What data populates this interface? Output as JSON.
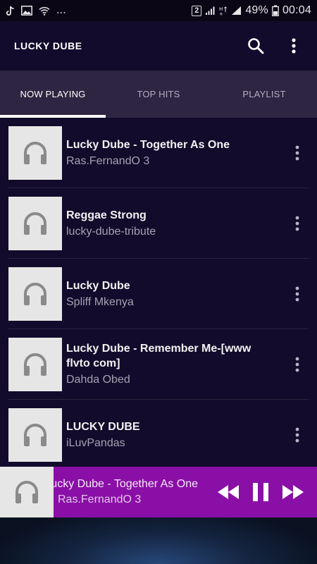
{
  "status_bar": {
    "notif_icons": [
      "tiktok-icon",
      "image-icon",
      "wifi-icon",
      "more-dots"
    ],
    "more": "...",
    "sim_badge": "2",
    "battery": "49%",
    "time": "00:04"
  },
  "app_bar": {
    "title": "LUCKY DUBE"
  },
  "tabs": [
    {
      "label": "NOW PLAYING",
      "active": true
    },
    {
      "label": "TOP HITS",
      "active": false
    },
    {
      "label": "PLAYLIST",
      "active": false
    }
  ],
  "tracks": [
    {
      "title": "Lucky Dube - Together As One",
      "subtitle": "Ras.FernandO 3"
    },
    {
      "title": "Reggae Strong",
      "subtitle": "lucky-dube-tribute"
    },
    {
      "title": "Lucky Dube",
      "subtitle": "Spliff Mkenya"
    },
    {
      "title": "Lucky Dube - Remember Me-[www flvto com]",
      "subtitle": "Dahda Obed"
    },
    {
      "title": "LUCKY DUBE",
      "subtitle": "iLuvPandas"
    }
  ],
  "player": {
    "title": "Lucky Dube - Together As One",
    "subtitle": "Ras.FernandO 3"
  },
  "colors": {
    "app_bar": "#120b2b",
    "tabs_bg": "#2e2542",
    "player_bg": "#8a0fa6",
    "thumb_bg": "#e6e6e6"
  }
}
